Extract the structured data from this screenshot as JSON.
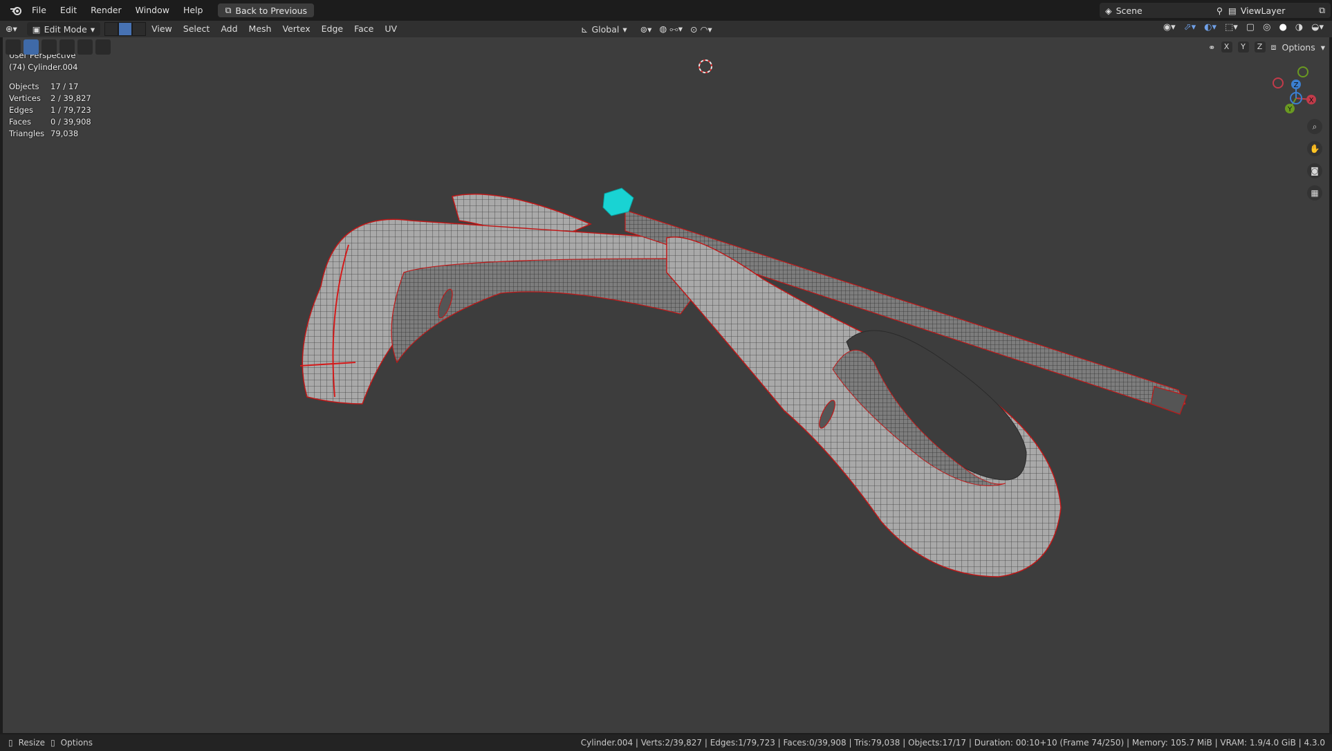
{
  "app": {
    "name": "Blender"
  },
  "topbar": {
    "menus": [
      "File",
      "Edit",
      "Render",
      "Window",
      "Help"
    ],
    "back_button": "Back to Previous",
    "scene": "Scene",
    "view_layer": "ViewLayer"
  },
  "header": {
    "mode": "Edit Mode",
    "menus": [
      "View",
      "Select",
      "Add",
      "Mesh",
      "Vertex",
      "Edge",
      "Face",
      "UV"
    ],
    "transform_orientation": "Global",
    "options": "Options",
    "axes": [
      "X",
      "Y",
      "Z"
    ]
  },
  "viewport": {
    "view_name": "User Perspective",
    "object_name": "(74) Cylinder.004",
    "stats": [
      {
        "label": "Objects",
        "value": "17 / 17"
      },
      {
        "label": "Vertices",
        "value": "2 / 39,827"
      },
      {
        "label": "Edges",
        "value": "1 / 79,723"
      },
      {
        "label": "Faces",
        "value": "0 / 39,908"
      },
      {
        "label": "Triangles",
        "value": "79,038"
      }
    ]
  },
  "gizmo": {
    "x": "X",
    "y": "Y",
    "z": "Z"
  },
  "statusbar": {
    "left_items": [
      "Resize",
      "Options"
    ],
    "summary": "Cylinder.004 | Verts:2/39,827 | Edges:1/79,723 | Faces:0/39,908 | Tris:79,038 | Objects:17/17 | Duration: 00:10+10 (Frame 74/250) | Memory: 105.7 MiB | VRAM: 1.9/4.0 GiB | 4.3.0"
  },
  "colors": {
    "accent": "#4772b3",
    "selection": "#19d3d3",
    "seam": "#e11b1b"
  }
}
